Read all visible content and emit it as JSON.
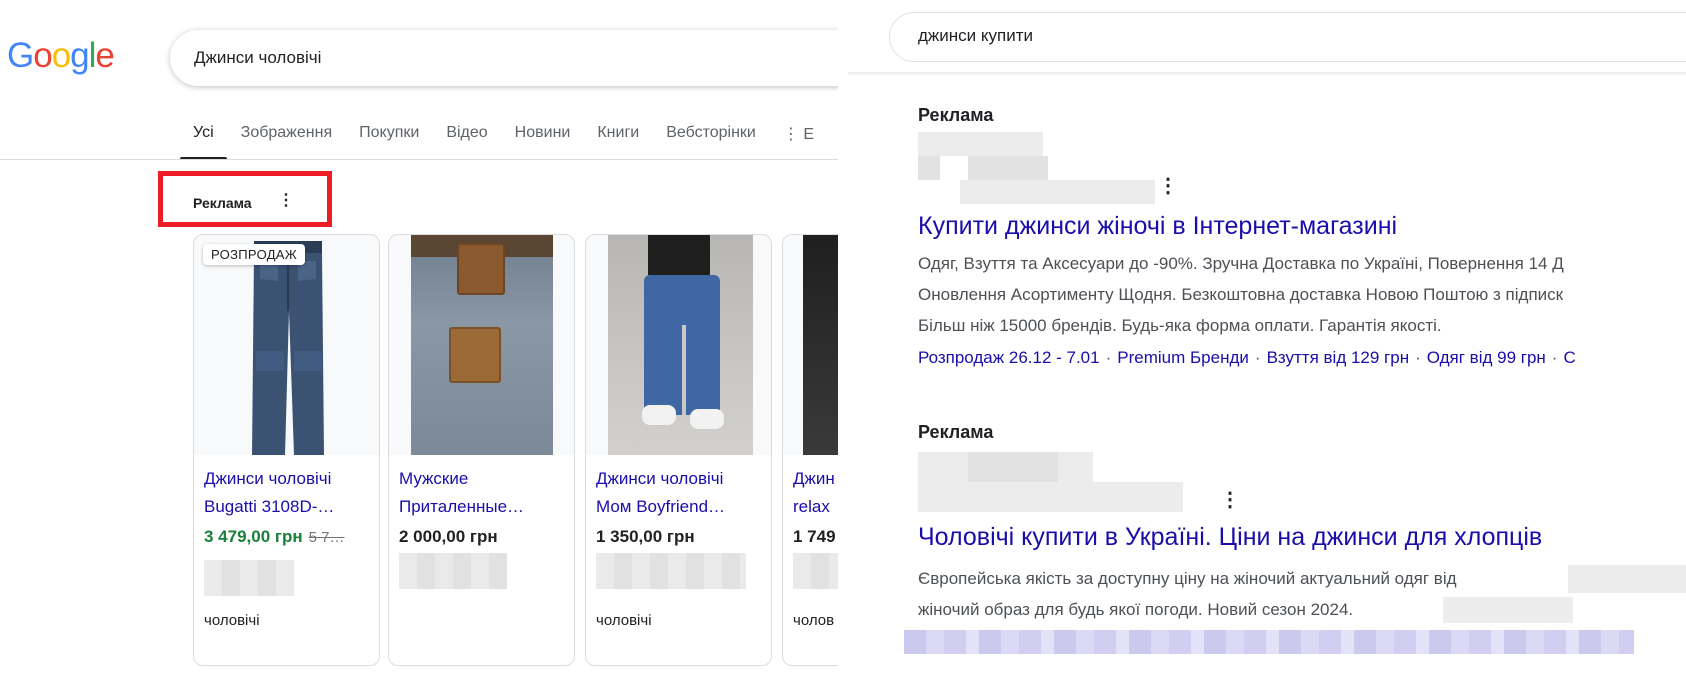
{
  "left": {
    "logo_letters": [
      {
        "ch": "G",
        "color": "#4285F4"
      },
      {
        "ch": "o",
        "color": "#EA4335"
      },
      {
        "ch": "o",
        "color": "#FBBC05"
      },
      {
        "ch": "g",
        "color": "#4285F4"
      },
      {
        "ch": "l",
        "color": "#34A853"
      },
      {
        "ch": "e",
        "color": "#EA4335"
      }
    ],
    "search_query": "Джинси чоловічі",
    "tabs": [
      "Усі",
      "Зображення",
      "Покупки",
      "Відео",
      "Новини",
      "Книги",
      "Вебсторінки",
      "⋮ Е"
    ],
    "ad_label": "Реклама",
    "ad_menu_icon": "⋮",
    "highlight_color": "#ee1c25",
    "cards": [
      {
        "badge": "РОЗПРОДАЖ",
        "title_line1": "Джинси чоловічі",
        "title_line2": "Bugatti 3108D-…",
        "price": "3 479,00 грн",
        "old_price": "5 7…",
        "category": "чоловічі"
      },
      {
        "title_line1": "Мужские",
        "title_line2": "Приталенные…",
        "price": "2 000,00 грн"
      },
      {
        "title_line1": "Джинси чоловічі",
        "title_line2": "Мом Boyfriend…",
        "price": "1 350,00 грн",
        "category": "чоловічі"
      },
      {
        "title_line1": "Джин",
        "title_line2": "relax",
        "price": "1 749",
        "category": "чолов"
      }
    ]
  },
  "right": {
    "search_query": "джинси купити",
    "ads": [
      {
        "label": "Реклама",
        "menu_icon": "⋮",
        "title": "Купити джинси жіночі в Інтернет-магазині",
        "desc": [
          "Одяг, Взуття та Аксесуари до -90%. Зручна Доставка по Україні, Повернення 14 Д",
          "Оновлення Асортименту Щодня. Безкоштовна доставка Новою Поштою з підписк",
          "Більш ніж 15000 брендів. Будь-яка форма оплати. Гарантія якості."
        ],
        "sitelinks": [
          "Розпродаж 26.12 - 7.01",
          "Premium Бренди",
          "Взуття від 129 грн",
          "Одяг від 99 грн",
          "С"
        ]
      },
      {
        "label": "Реклама",
        "menu_icon": "⋮",
        "title": "Чоловічі купити в Україні. Ціни на джинси для хлопців",
        "desc": [
          "Європейська якість за доступну ціну на жіночий актуальний одяг від",
          "жіночий образ для будь якої погоди. Новий сезон 2024."
        ]
      }
    ]
  }
}
